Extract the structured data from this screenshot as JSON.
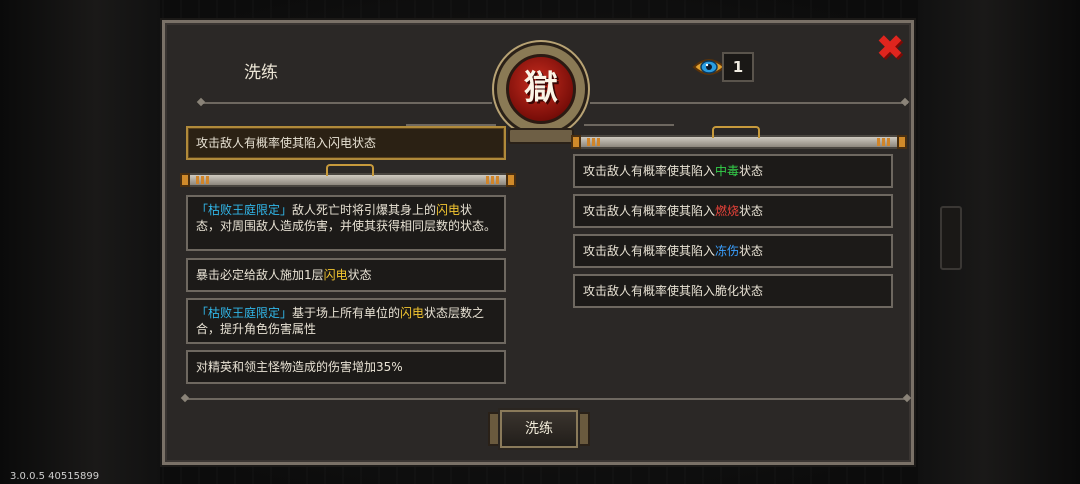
{
  "panel": {
    "title": "洗练"
  },
  "emblem": {
    "glyph": "獄"
  },
  "currency": {
    "icon": "eye-gem-icon",
    "count": "1"
  },
  "left_selected": {
    "text": "攻击敌人有概率使其陷入闪电状态"
  },
  "left_items": [
    {
      "tag": "「枯败王庭限定」",
      "a": "敌人死亡时将引爆其身上的",
      "b": "闪电",
      "c": "状态，对周围敌人造成伤害，并使其获得相同层数的状态。"
    },
    {
      "pre": "暴击必定给敌人施加1层",
      "hl": "闪电",
      "post": "状态"
    },
    {
      "tag": "「枯败王庭限定」",
      "a": "基于场上所有单位的",
      "b": "闪电",
      "c": "状态层数之合，提升角色伤害属性"
    },
    {
      "text": "对精英和领主怪物造成的伤害增加35%"
    }
  ],
  "right_items": [
    {
      "pre": "攻击敌人有概率使其陷入",
      "hl": "中毒",
      "post": "状态"
    },
    {
      "pre": "攻击敌人有概率使其陷入",
      "hl": "燃烧",
      "post": "状态"
    },
    {
      "pre": "攻击敌人有概率使其陷入",
      "hl": "冻伤",
      "post": "状态"
    },
    {
      "pre": "攻击敌人有概率使其陷入脆化状态",
      "hl": "",
      "post": ""
    }
  ],
  "button": {
    "label": "洗练"
  },
  "close": {
    "icon": "close-icon",
    "glyph": "✖"
  },
  "version": "3.0.0.5 40515899",
  "colors": {
    "highlight_yellow": "#f2c530",
    "tag_blue": "#31b6e8",
    "poison": "#33d14a",
    "burn": "#e8423a",
    "frost": "#3aa0ff"
  }
}
